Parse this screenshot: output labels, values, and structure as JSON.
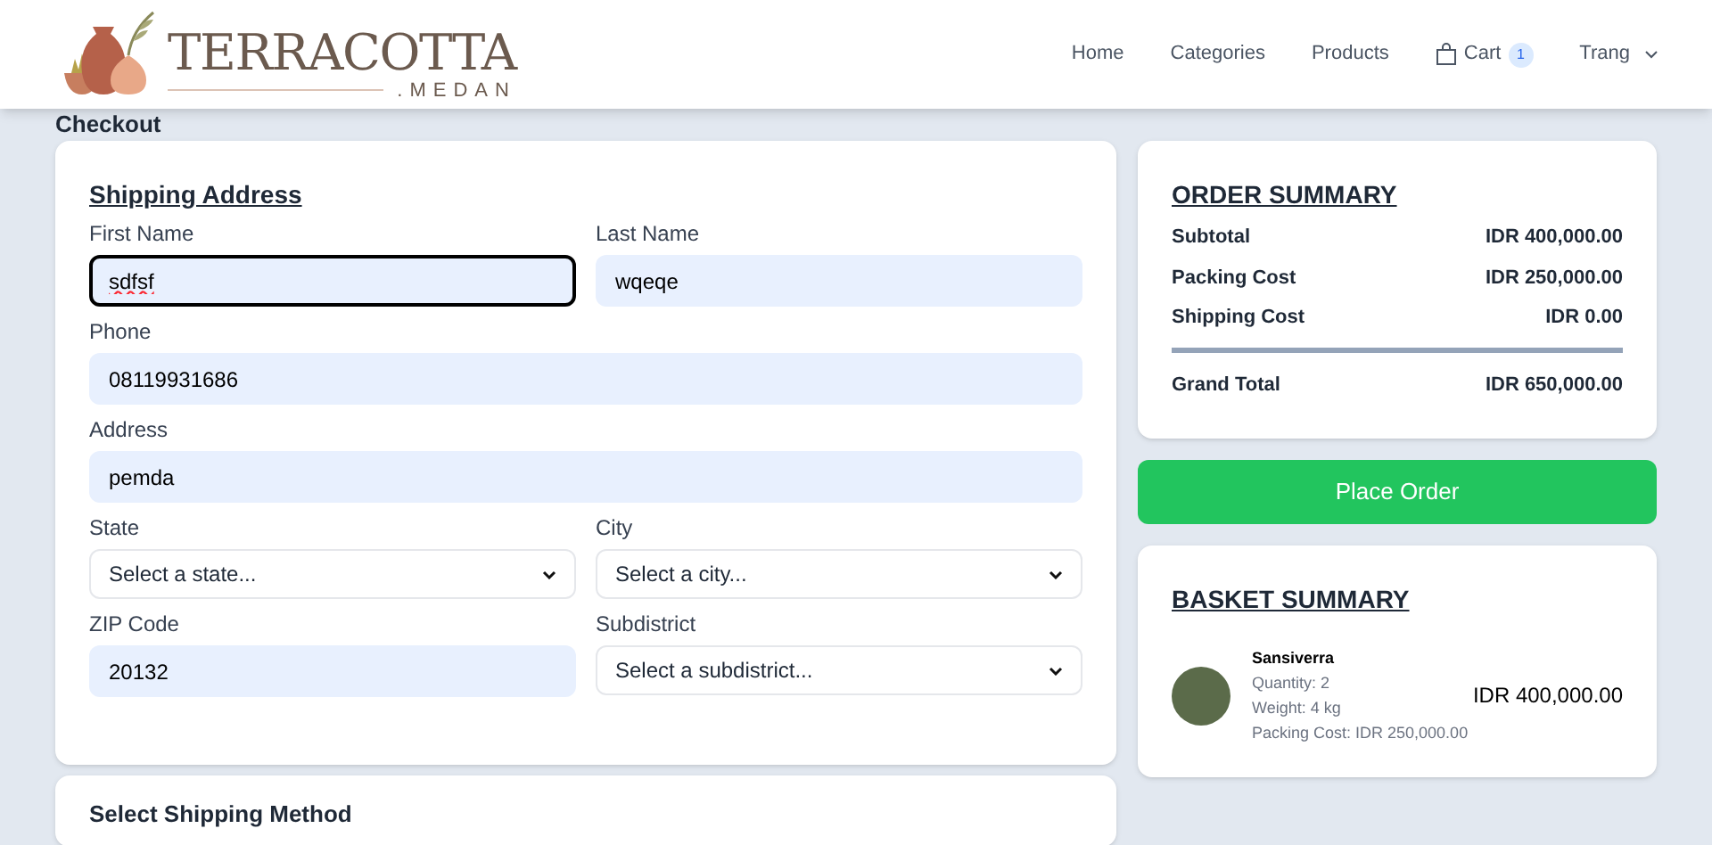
{
  "header": {
    "logo": {
      "name": "TERRACOTTA",
      "subtitle": ".MEDAN"
    },
    "nav": [
      {
        "label": "Home"
      },
      {
        "label": "Categories"
      },
      {
        "label": "Products"
      }
    ],
    "cart": {
      "label": "Cart",
      "count": "1"
    },
    "user": {
      "label": "Trang"
    }
  },
  "page_title": "Checkout",
  "shipping_address": {
    "title": "Shipping Address",
    "fields": [
      {
        "kind": "input",
        "label": "First Name",
        "value": "sdfsf",
        "focused": true,
        "misspelled": true
      },
      {
        "kind": "input",
        "label": "Last Name",
        "value": "wqeqe",
        "focused": false,
        "misspelled": false
      },
      {
        "kind": "input",
        "label": "Phone",
        "value": "08119931686",
        "focused": false,
        "misspelled": false,
        "wide": true
      },
      {
        "kind": "input",
        "label": "Address",
        "value": "pemda",
        "focused": false,
        "misspelled": false,
        "wide": true
      },
      {
        "kind": "select",
        "label": "State",
        "placeholder": "Select a state..."
      },
      {
        "kind": "select",
        "label": "City",
        "placeholder": "Select a city..."
      },
      {
        "kind": "input",
        "label": "ZIP Code",
        "value": "20132",
        "focused": false,
        "misspelled": false
      },
      {
        "kind": "select",
        "label": "Subdistrict",
        "placeholder": "Select a subdistrict..."
      }
    ]
  },
  "shipping_method": {
    "title": "Select Shipping Method"
  },
  "order_summary": {
    "title": "ORDER SUMMARY",
    "rows": [
      {
        "label": "Subtotal",
        "value": "IDR 400,000.00"
      },
      {
        "label": "Packing Cost",
        "value": "IDR 250,000.00"
      },
      {
        "label": "Shipping Cost",
        "value": "IDR 0.00"
      }
    ],
    "total": {
      "label": "Grand Total",
      "value": "IDR 650,000.00"
    }
  },
  "place_order": {
    "label": "Place Order"
  },
  "basket_summary": {
    "title": "BASKET SUMMARY",
    "items": [
      {
        "name": "Sansiverra",
        "details": [
          "Quantity: 2",
          "Weight: 4 kg",
          "Packing Cost: IDR 250,000.00"
        ],
        "price": "IDR 400,000.00"
      }
    ]
  }
}
